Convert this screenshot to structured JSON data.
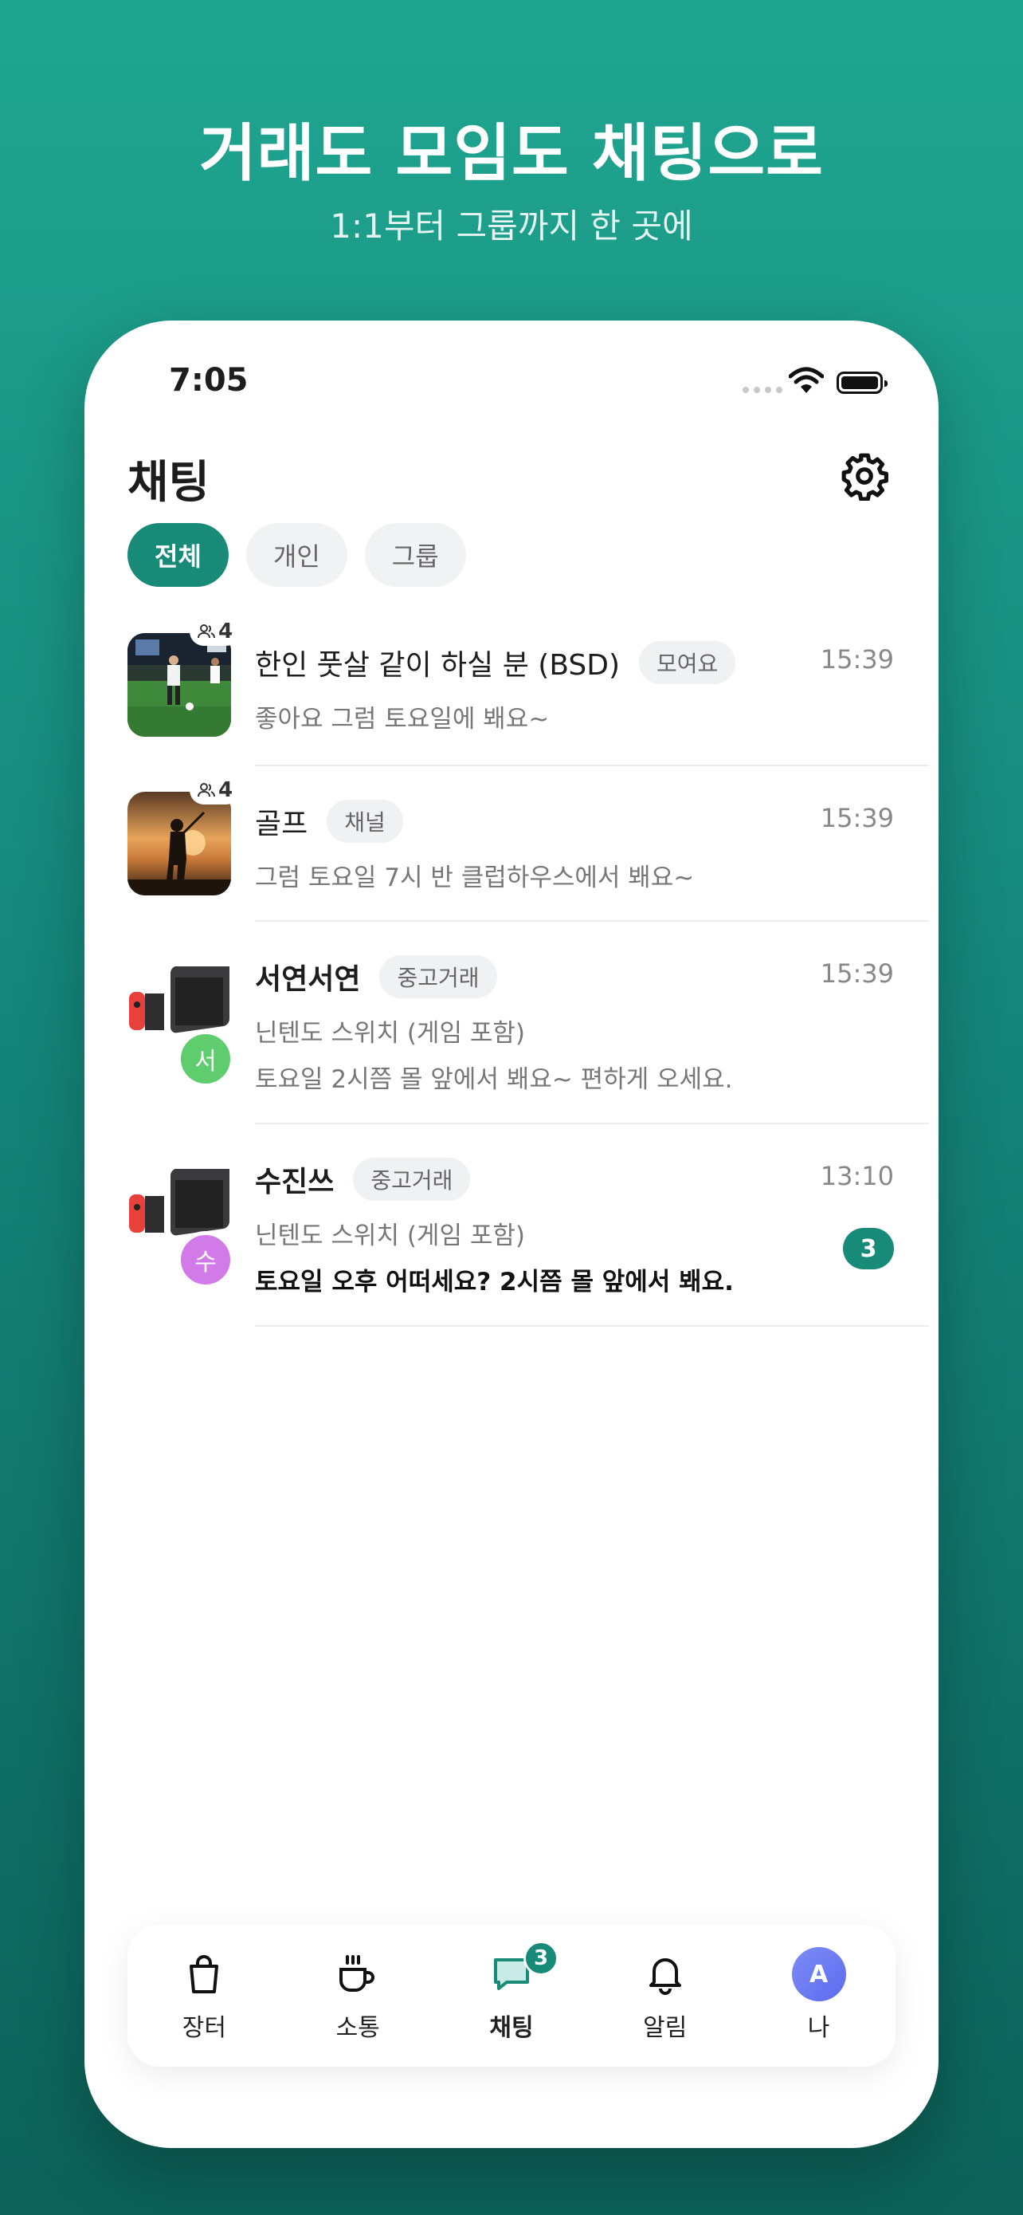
{
  "promo": {
    "title": "거래도 모임도 채팅으로",
    "subtitle": "1:1부터 그룹까지 한 곳에"
  },
  "status_bar": {
    "time": "7:05"
  },
  "header": {
    "title": "채팅",
    "settings_icon": "gear-icon"
  },
  "filters": [
    {
      "label": "전체",
      "active": true
    },
    {
      "label": "개인",
      "active": false
    },
    {
      "label": "그룹",
      "active": false
    }
  ],
  "chats": [
    {
      "name": "한인 풋살 같이 하실 분 (BSD)",
      "tag": "모여요",
      "time": "15:39",
      "member_count": "4",
      "preview": "좋아요 그럼 토요일에 봬요~"
    },
    {
      "name": "골프",
      "tag": "채널",
      "time": "15:39",
      "member_count": "4",
      "preview": "그럼 토요일 7시 반 클럽하우스에서 봬요~"
    },
    {
      "name": "서연서연",
      "tag": "중고거래",
      "time": "15:39",
      "item": "닌텐도 스위치 (게임 포함)",
      "preview": "토요일 2시쯤 몰 앞에서 봬요~ 편하게 오세요.",
      "avatar_initial": "서",
      "avatar_color": "#5fcc6e"
    },
    {
      "name": "수진쓰",
      "tag": "중고거래",
      "time": "13:10",
      "item": "닌텐도 스위치 (게임 포함)",
      "preview": "토요일 오후 어떠세요? 2시쯤 몰 앞에서 봬요.",
      "avatar_initial": "수",
      "avatar_color": "#d27ae8",
      "unread": "3"
    }
  ],
  "tabbar": [
    {
      "label": "장터",
      "icon": "shopping-bag-icon"
    },
    {
      "label": "소통",
      "icon": "coffee-cup-icon"
    },
    {
      "label": "채팅",
      "icon": "chat-bubble-icon",
      "badge": "3",
      "active": true
    },
    {
      "label": "알림",
      "icon": "bell-icon"
    },
    {
      "label": "나",
      "icon": "avatar",
      "avatar_initial": "A"
    }
  ],
  "colors": {
    "accent": "#178a78",
    "background_top": "#1fa690",
    "background_bottom": "#0c6158"
  }
}
